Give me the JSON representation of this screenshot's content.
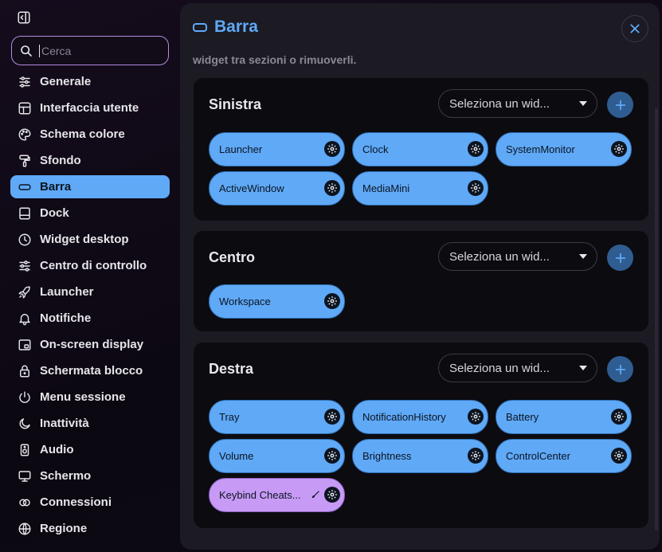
{
  "sidebar": {
    "search_placeholder": "Cerca",
    "items": [
      {
        "label": "Generale",
        "icon": "sliders-icon"
      },
      {
        "label": "Interfaccia utente",
        "icon": "layout-icon"
      },
      {
        "label": "Schema colore",
        "icon": "palette-icon"
      },
      {
        "label": "Sfondo",
        "icon": "paint-roller-icon"
      },
      {
        "label": "Barra",
        "icon": "bar-icon",
        "active": true
      },
      {
        "label": "Dock",
        "icon": "dock-icon"
      },
      {
        "label": "Widget desktop",
        "icon": "clock-icon"
      },
      {
        "label": "Centro di controllo",
        "icon": "sliders-icon"
      },
      {
        "label": "Launcher",
        "icon": "rocket-icon"
      },
      {
        "label": "Notifiche",
        "icon": "bell-icon"
      },
      {
        "label": "On-screen display",
        "icon": "osd-icon"
      },
      {
        "label": "Schermata blocco",
        "icon": "lock-icon"
      },
      {
        "label": "Menu sessione",
        "icon": "power-icon"
      },
      {
        "label": "Inattività",
        "icon": "moon-icon"
      },
      {
        "label": "Audio",
        "icon": "speaker-icon"
      },
      {
        "label": "Schermo",
        "icon": "monitor-icon"
      },
      {
        "label": "Connessioni",
        "icon": "link-icon"
      },
      {
        "label": "Regione",
        "icon": "globe-icon"
      }
    ]
  },
  "main": {
    "title": "Barra",
    "description": "widget tra sezioni o rimuoverli.",
    "select_placeholder": "Seleziona un wid...",
    "sections": [
      {
        "title": "Sinistra",
        "widgets": [
          "Launcher",
          "Clock",
          "SystemMonitor",
          "ActiveWindow",
          "MediaMini"
        ]
      },
      {
        "title": "Centro",
        "widgets": [
          "Workspace"
        ]
      },
      {
        "title": "Destra",
        "widgets": [
          "Tray",
          "NotificationHistory",
          "Battery",
          "Volume",
          "Brightness",
          "ControlCenter",
          "Keybind Cheats..."
        ]
      }
    ]
  },
  "colors": {
    "accent": "#5fa9f7",
    "custom_widget": "#c79af5",
    "search_border": "#b58be0"
  }
}
